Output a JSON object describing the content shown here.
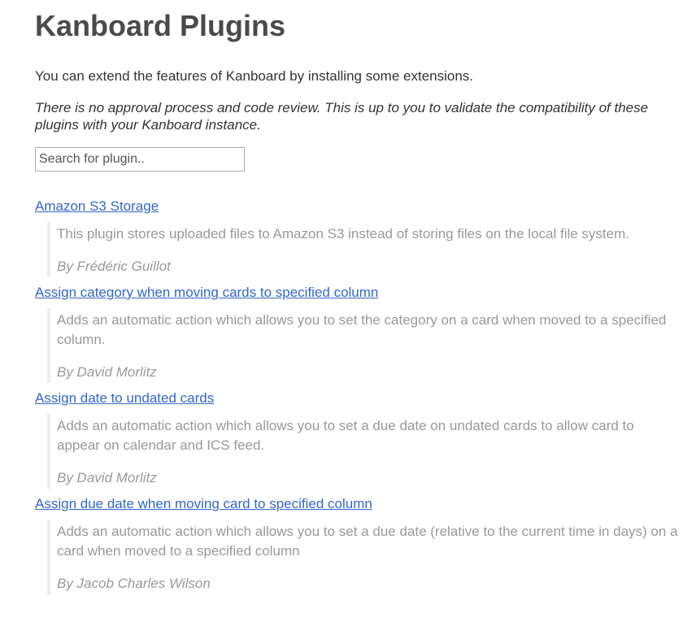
{
  "header": {
    "title": "Kanboard Plugins"
  },
  "intro": {
    "text": "You can extend the features of Kanboard by installing some extensions.",
    "disclaimer": "There is no approval process and code review. This is up to you to validate the compatibility of these plugins with your Kanboard instance."
  },
  "search": {
    "placeholder": "Search for plugin..",
    "value": ""
  },
  "plugins": [
    {
      "title": "Amazon S3 Storage",
      "description": "This plugin stores uploaded files to Amazon S3 instead of storing files on the local file system.",
      "author": "By Frédéric Guillot"
    },
    {
      "title": "Assign category when moving cards to specified column",
      "description": "Adds an automatic action which allows you to set the category on a card when moved to a specified column.",
      "author": "By David Morlitz"
    },
    {
      "title": "Assign date to undated cards",
      "description": "Adds an automatic action which allows you to set a due date on undated cards to allow card to appear on calendar and ICS feed.",
      "author": "By David Morlitz"
    },
    {
      "title": "Assign due date when moving card to specified column",
      "description": "Adds an automatic action which allows you to set a due date (relative to the current time in days) on a card when moved to a specified column",
      "author": "By Jacob Charles Wilson"
    }
  ],
  "colors": {
    "link": "#3366cc",
    "muted_text": "#999999",
    "quote_border": "#eeeeee",
    "heading": "#4a4a4a"
  }
}
